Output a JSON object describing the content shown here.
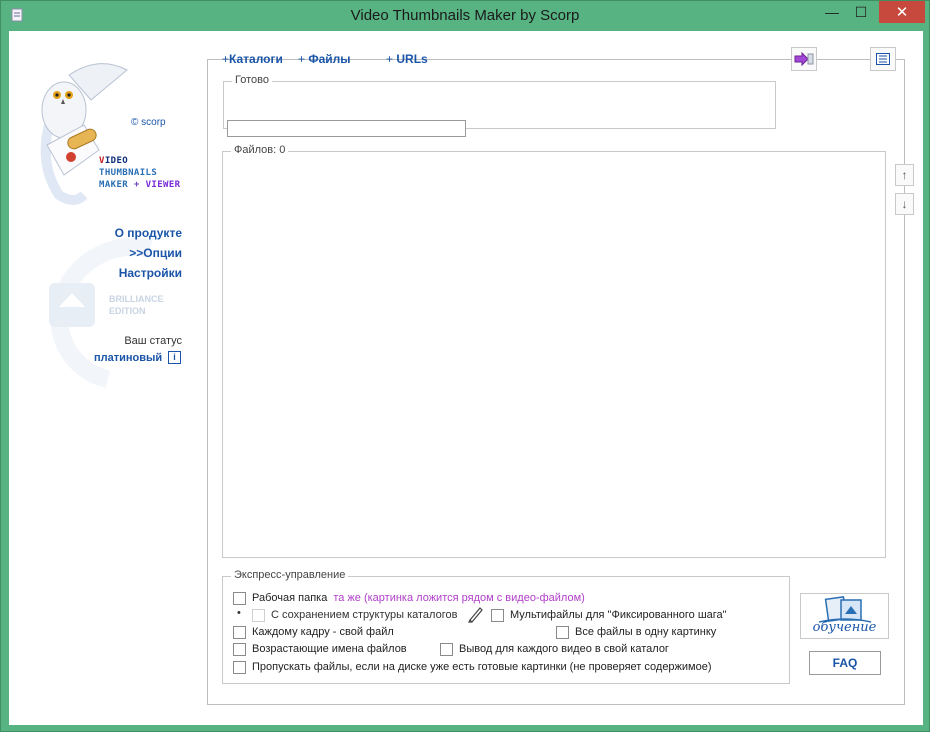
{
  "window": {
    "title": "Video Thumbnails Maker by Scorp",
    "minimize": "—",
    "maximize": "☐",
    "close": "✕"
  },
  "sidebar": {
    "copyright": "© scorp",
    "brand_line1_first": "V",
    "brand_line1_rest": "IDEO",
    "brand_line2": "THUMBNAILS",
    "brand_line3_a": "MAKER",
    "brand_line3_plus": "+",
    "brand_line3_b": "VIEWER",
    "links": {
      "about": "О продукте",
      "options": ">>Опции",
      "settings": "Настройки"
    },
    "edition_line1": "BRILLIANCE",
    "edition_line2": "EDITION",
    "status_label": "Ваш статус",
    "status_value": "платиновый",
    "info_glyph": "i"
  },
  "toolbar": {
    "plus": "+",
    "catalogs": "Каталоги",
    "files": "Файлы",
    "urls": "URLs"
  },
  "ready_group": {
    "legend": "Готово"
  },
  "files_group": {
    "legend": "Файлов: 0"
  },
  "reorder": {
    "up": "↑",
    "down": "↓"
  },
  "express": {
    "legend": "Экспресс-управление",
    "work_folder_label": "Рабочая папка",
    "work_folder_value": "та же (картинка ложится рядом с видео-файлом)",
    "bullet": "•",
    "keep_structure": "С сохранением структуры каталогов",
    "multifiles": "Мультифайлы для \"Фиксированного шага\"",
    "each_frame": "Каждому кадру - свой файл",
    "all_files_one": "Все файлы в одну картинку",
    "ascending_names": "Возрастающие имена файлов",
    "each_video_dir": "Вывод для каждого видео в свой каталог",
    "skip_existing": "Пропускать файлы, если на диске уже есть готовые картинки (не проверяет содержимое)"
  },
  "side_buttons": {
    "education": "обучение",
    "faq": "FAQ"
  },
  "colors": {
    "titlebar": "#58b383",
    "close": "#c7493d",
    "link": "#1a55a8",
    "folder_value": "#b03ec9"
  },
  "icons": {
    "app": "app-icon",
    "owl": "owl-logo",
    "list": "list-icon",
    "export": "export-arrow-icon",
    "pen": "pen-icon"
  }
}
